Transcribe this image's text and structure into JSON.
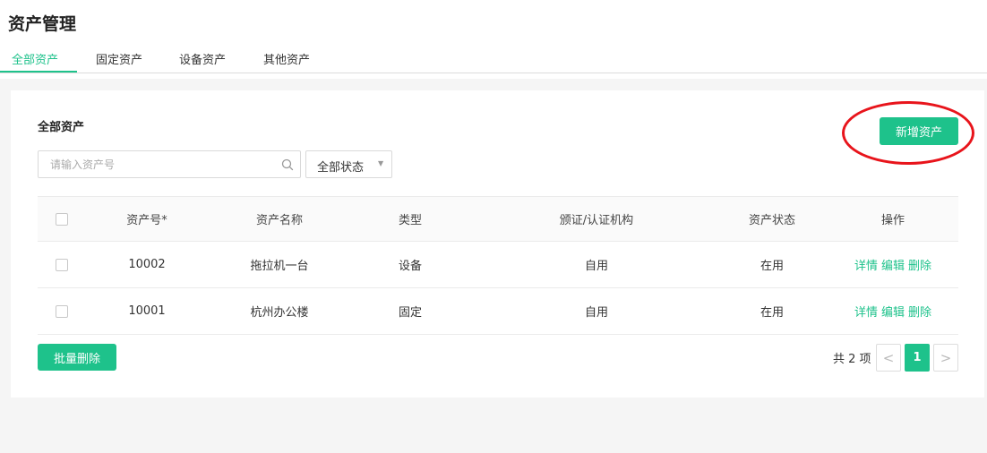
{
  "header": {
    "title": "资产管理"
  },
  "tabs": [
    {
      "label": "全部资产",
      "active": true
    },
    {
      "label": "固定资产",
      "active": false
    },
    {
      "label": "设备资产",
      "active": false
    },
    {
      "label": "其他资产",
      "active": false
    }
  ],
  "card": {
    "title": "全部资产",
    "add_button": "新增资产",
    "batch_delete_button": "批量删除"
  },
  "filters": {
    "search_placeholder": "请输入资产号",
    "search_value": "",
    "status_select": "全部状态"
  },
  "table": {
    "columns": [
      "资产号*",
      "资产名称",
      "类型",
      "颁证/认证机构",
      "资产状态",
      "操作"
    ],
    "rows": [
      {
        "id": "10002",
        "name": "拖拉机一台",
        "type": "设备",
        "org": "自用",
        "status": "在用"
      },
      {
        "id": "10001",
        "name": "杭州办公楼",
        "type": "固定",
        "org": "自用",
        "status": "在用"
      }
    ],
    "actions": {
      "detail": "详情",
      "edit": "编辑",
      "delete": "删除"
    }
  },
  "pagination": {
    "total": "共 2 项",
    "current_page": "1",
    "prev": "<",
    "next": ">"
  },
  "colors": {
    "accent": "#1ec28b",
    "annotation": "#e8141b"
  },
  "icons": {
    "search": "search-icon",
    "dropdown": "caret-down-icon"
  }
}
